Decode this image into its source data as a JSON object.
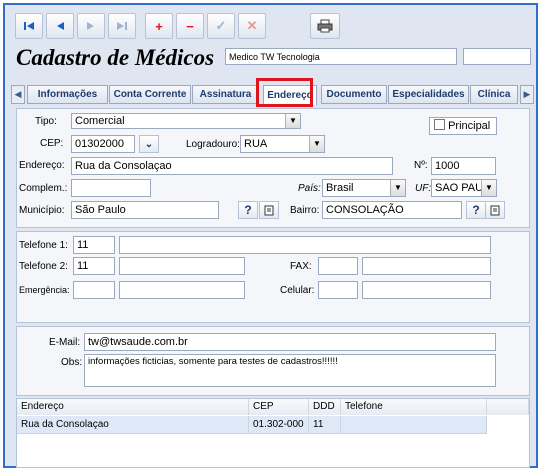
{
  "toolbar": {
    "first_icon": "first-record-icon",
    "prev_icon": "previous-record-icon",
    "next_icon": "next-record-icon",
    "last_icon": "last-record-icon",
    "add_label": "+",
    "remove_label": "−",
    "confirm_label": "✓",
    "cancel_label": "✕",
    "print_icon": "printer-icon"
  },
  "header": {
    "title": "Cadastro de Médicos",
    "company": "Medico TW Tecnologia",
    "extra": ""
  },
  "tabs": [
    {
      "label": "Informações"
    },
    {
      "label": "Conta Corrente"
    },
    {
      "label": "Assinatura"
    },
    {
      "label": "Endereço"
    },
    {
      "label": "Documento"
    },
    {
      "label": "Especialidades"
    },
    {
      "label": "Clínica"
    }
  ],
  "address": {
    "tipo_label": "Tipo:",
    "tipo_value": "Comercial",
    "principal_label": "Principal",
    "principal_checked": false,
    "cep_label": "CEP:",
    "cep_value": "01302000",
    "logradouro_label": "Logradouro:",
    "logradouro_value": "RUA",
    "endereco_label": "Endereço:",
    "endereco_value": "Rua da Consolaçao",
    "numero_label": "Nº:",
    "numero_value": "1000",
    "complemento_label": "Complem.:",
    "complemento_value": "",
    "pais_label": "País:",
    "pais_value": "Brasil",
    "uf_label": "UF:",
    "uf_value": "SAO PAUL",
    "municipio_label": "Município:",
    "municipio_value": "São Paulo",
    "bairro_label": "Bairro:",
    "bairro_value": "CONSOLAÇÃO",
    "help_label": "?"
  },
  "phones": {
    "tel1_label": "Telefone 1:",
    "tel1_ddd": "11",
    "tel1_number": "",
    "tel2_label": "Telefone 2:",
    "tel2_ddd": "11",
    "tel2_number": "",
    "fax_label": "FAX:",
    "fax_ddd": "",
    "fax_number": "",
    "emergencia_label": "Emergência:",
    "emergencia_ddd": "",
    "emergencia_number": "",
    "celular_label": "Celular:",
    "celular_ddd": "",
    "celular_number": ""
  },
  "contact": {
    "email_label": "E-Mail:",
    "email_value": "tw@twsaude.com.br",
    "obs_label": "Obs:",
    "obs_value": "informações ficticias, somente para testes de cadastros!!!!!!"
  },
  "grid": {
    "columns": [
      "Endereço",
      "CEP",
      "DDD",
      "Telefone"
    ],
    "rows": [
      [
        "Rua da Consolaçao",
        "01.302-000",
        "11",
        ""
      ]
    ]
  },
  "colors": {
    "accent": "#2f6fc9",
    "highlight": "#e0141d"
  }
}
